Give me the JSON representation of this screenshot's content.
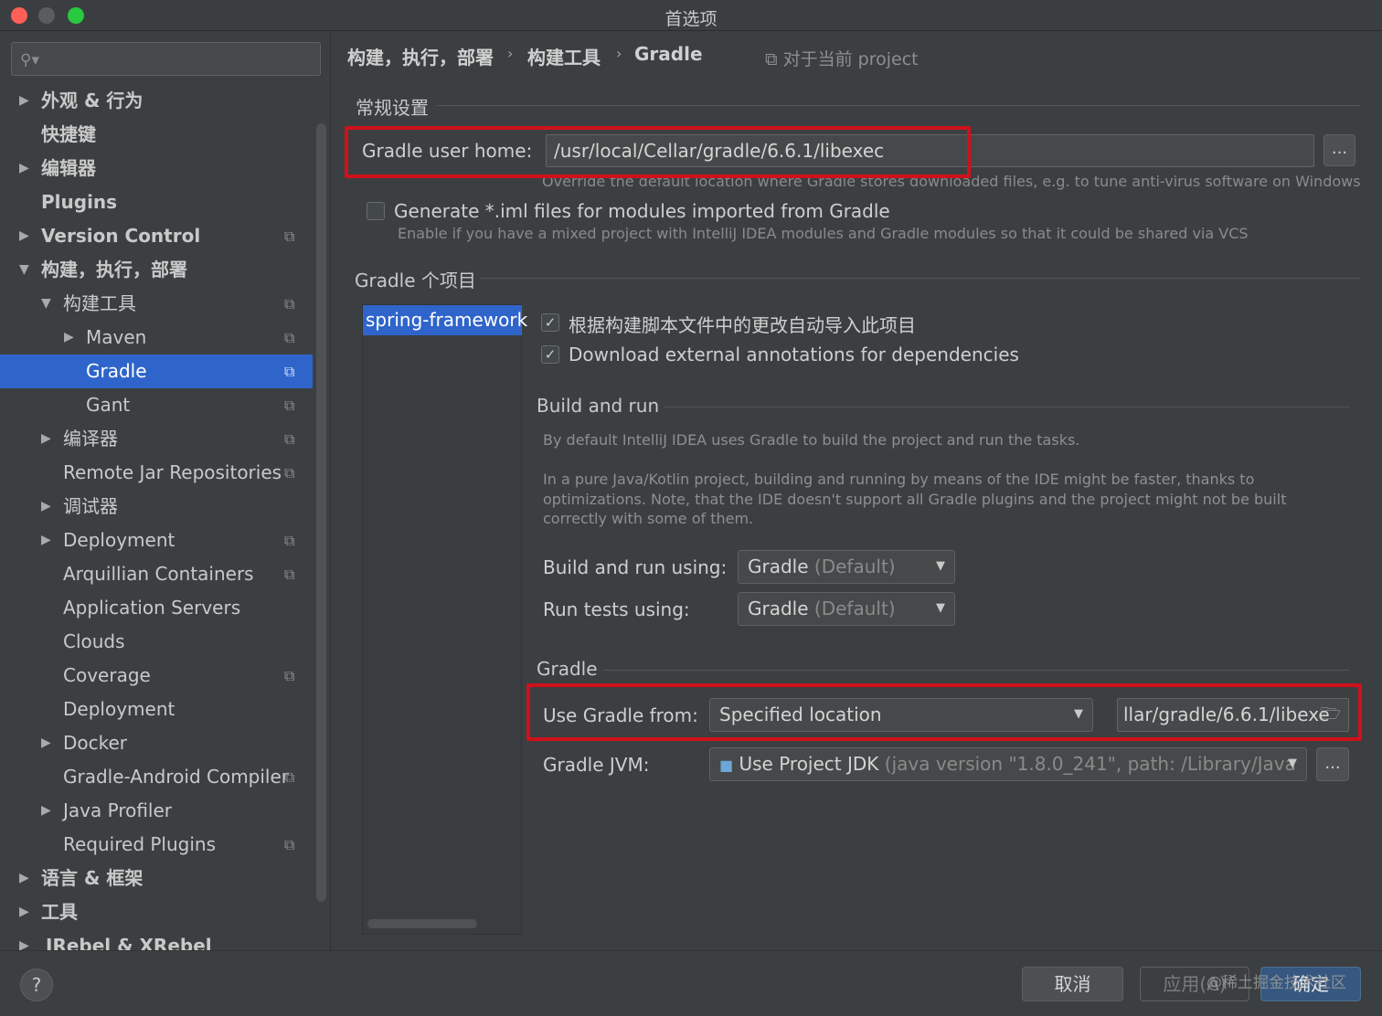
{
  "window": {
    "title": "首选项"
  },
  "search": {
    "placeholder": ""
  },
  "sidebar": {
    "items": [
      {
        "label": "外观 & 行为"
      },
      {
        "label": "快捷键"
      },
      {
        "label": "编辑器"
      },
      {
        "label": "Plugins"
      },
      {
        "label": "Version Control"
      },
      {
        "label": "构建，执行，部署"
      },
      {
        "label": "构建工具"
      },
      {
        "label": "Maven"
      },
      {
        "label": "Gradle"
      },
      {
        "label": "Gant"
      },
      {
        "label": "编译器"
      },
      {
        "label": "Remote Jar Repositories"
      },
      {
        "label": "调试器"
      },
      {
        "label": "Deployment"
      },
      {
        "label": "Arquillian Containers"
      },
      {
        "label": "Application Servers"
      },
      {
        "label": "Clouds"
      },
      {
        "label": "Coverage"
      },
      {
        "label": "Deployment"
      },
      {
        "label": "Docker"
      },
      {
        "label": "Gradle-Android Compiler"
      },
      {
        "label": "Java Profiler"
      },
      {
        "label": "Required Plugins"
      },
      {
        "label": "语言 & 框架"
      },
      {
        "label": "工具"
      },
      {
        "label": "JRebel & XRebel"
      }
    ]
  },
  "breadcrumb": {
    "part1": "构建，执行，部署",
    "part2": "构建工具",
    "part3": "Gradle",
    "scope": "对于当前 project"
  },
  "general": {
    "heading": "常规设置",
    "user_home_label": "Gradle user home:",
    "user_home_value": "/usr/local/Cellar/gradle/6.6.1/libexec",
    "user_home_hint": "Override the default location where Gradle stores downloaded files, e.g. to tune anti-virus software on Windows",
    "browse_label": "...",
    "iml_label": "Generate *.iml files for modules imported from Gradle",
    "iml_hint": "Enable if you have a mixed project with IntelliJ IDEA modules and Gradle modules so that it could be shared via VCS"
  },
  "projects": {
    "heading": "Gradle 个项目",
    "items": [
      "spring-framework"
    ]
  },
  "project_settings": {
    "auto_import_label": "根据构建脚本文件中的更改自动导入此项目",
    "annotations_label": "Download external annotations for dependencies",
    "build_run_heading": "Build and run",
    "build_run_p1": "By default IntelliJ IDEA uses Gradle to build the project and run the tasks.",
    "build_run_p2": "In a pure Java/Kotlin project, building and running by means of the IDE might be faster, thanks to optimizations. Note, that the IDE doesn't support all Gradle plugins and the project might not be built correctly with some of them.",
    "build_using_label": "Build and run using:",
    "build_using_value": "Gradle",
    "build_using_suffix": "(Default)",
    "tests_using_label": "Run tests using:",
    "tests_using_value": "Gradle",
    "tests_using_suffix": "(Default)",
    "gradle_heading": "Gradle",
    "use_from_label": "Use Gradle from:",
    "use_from_value": "Specified location",
    "location_value": "llar/gradle/6.6.1/libexe",
    "jvm_label": "Gradle JVM:",
    "jvm_value": "Use Project JDK",
    "jvm_detail": "(java version \"1.8.0_241\", path: /Library/Java",
    "jvm_browse_label": "..."
  },
  "footer": {
    "cancel_label": "取消",
    "apply_label": "应用(A)",
    "ok_label": "确定",
    "watermark": "@稀土掘金技术社区"
  },
  "colors": {
    "selection": "#2f65ca",
    "highlight_box": "#d0111b",
    "background": "#3c3f41"
  }
}
